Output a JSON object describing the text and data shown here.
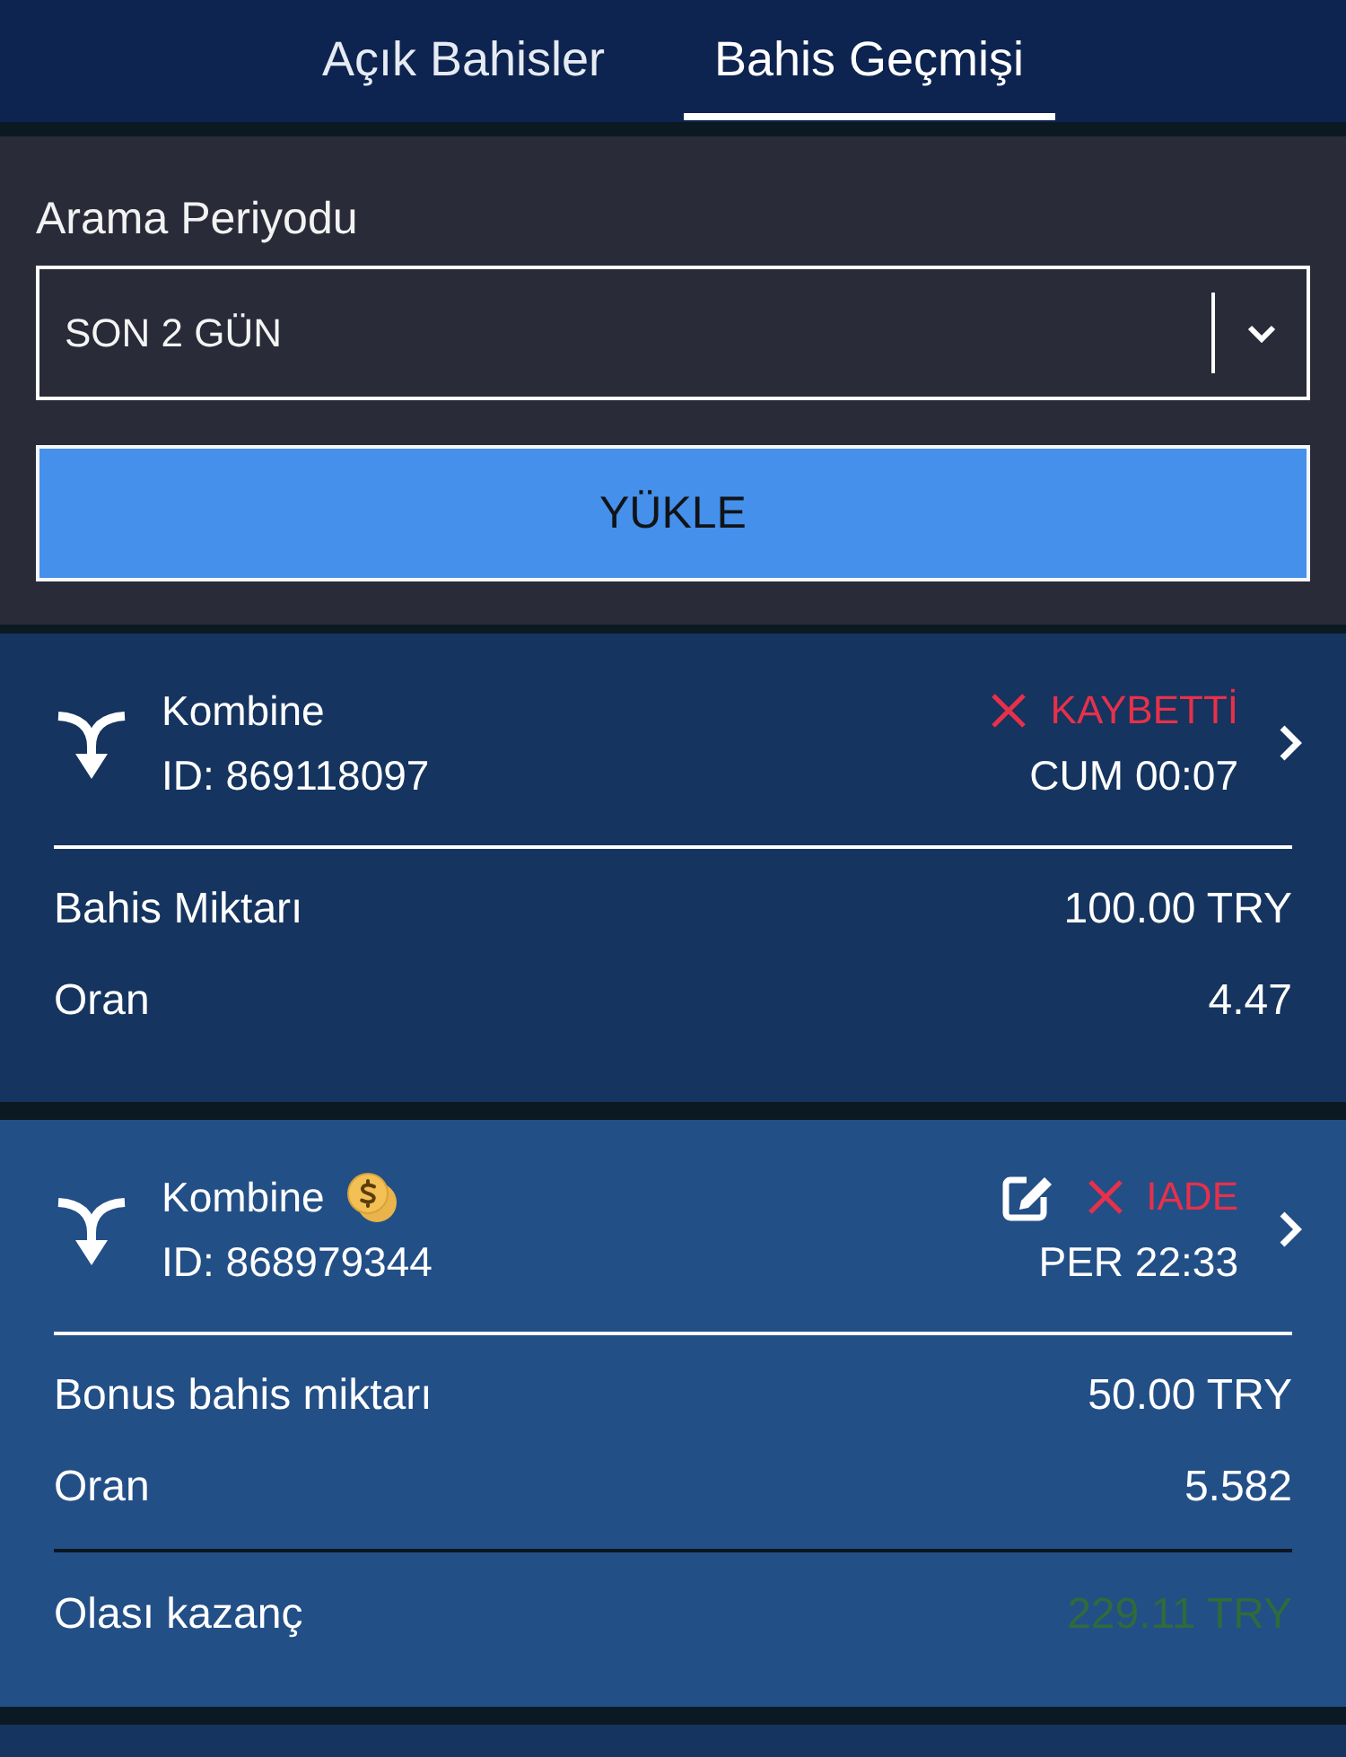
{
  "tabs": [
    {
      "label": "Açık Bahisler",
      "selected": false
    },
    {
      "label": "Bahis Geçmişi",
      "selected": true
    }
  ],
  "filter": {
    "label": "Arama Periyodu",
    "period_select": {
      "value": "SON 2 GÜN"
    },
    "load_button": "YÜKLE"
  },
  "bets": [
    {
      "selected": false,
      "type": "Kombine",
      "bonus": false,
      "id": "ID: 869118097",
      "editable": false,
      "status": "KAYBETTİ",
      "time": "CUM 00:07",
      "rows": [
        {
          "label": "Bahis Miktarı",
          "value": "100.00 TRY"
        },
        {
          "label": "Oran",
          "value": "4.47"
        }
      ]
    },
    {
      "selected": true,
      "type": "Kombine",
      "bonus": true,
      "id": "ID: 868979344",
      "editable": true,
      "status": "IADE",
      "time": "PER 22:33",
      "rows": [
        {
          "label": "Bonus bahis miktarı",
          "value": "50.00 TRY"
        },
        {
          "label": "Oran",
          "value": "5.582"
        }
      ],
      "potential_win": {
        "label": "Olası kazanç",
        "value": "229.11 TRY"
      }
    }
  ]
}
